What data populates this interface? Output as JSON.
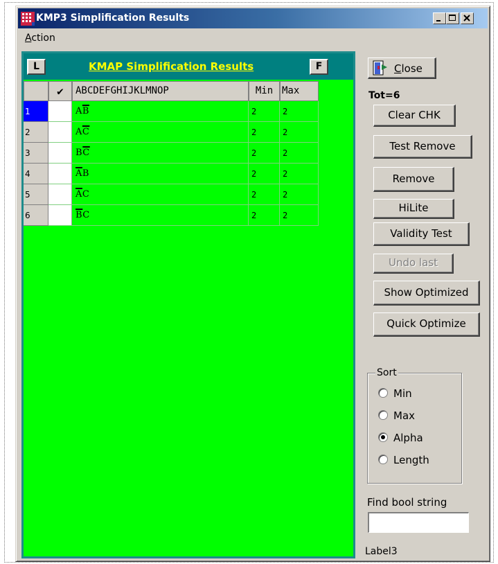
{
  "window": {
    "title": "KMP3 Simplification Results"
  },
  "menu": {
    "action_first": "A",
    "action_rest": "ction"
  },
  "grid": {
    "left_button": "L",
    "right_button": "F",
    "header_title": "KMAP Simplification Results",
    "columns": {
      "check": "✔",
      "terms": "ABCDEFGHIJKLMNOP",
      "min": "Min",
      "max": "Max"
    },
    "rows": [
      {
        "num": "1",
        "parts": [
          [
            "A",
            false
          ],
          [
            "B",
            true
          ]
        ],
        "min": "2",
        "max": "2",
        "selected": true
      },
      {
        "num": "2",
        "parts": [
          [
            "A",
            false
          ],
          [
            "C",
            true
          ]
        ],
        "min": "2",
        "max": "2",
        "selected": false
      },
      {
        "num": "3",
        "parts": [
          [
            "B",
            false
          ],
          [
            "C",
            true
          ]
        ],
        "min": "2",
        "max": "2",
        "selected": false
      },
      {
        "num": "4",
        "parts": [
          [
            "A",
            true
          ],
          [
            "B",
            false
          ]
        ],
        "min": "2",
        "max": "2",
        "selected": false
      },
      {
        "num": "5",
        "parts": [
          [
            "A",
            true
          ],
          [
            "C",
            false
          ]
        ],
        "min": "2",
        "max": "2",
        "selected": false
      },
      {
        "num": "6",
        "parts": [
          [
            "B",
            true
          ],
          [
            "C",
            false
          ]
        ],
        "min": "2",
        "max": "2",
        "selected": false
      }
    ]
  },
  "side": {
    "close_first": "C",
    "close_rest": "lose",
    "total": "Tot=6",
    "clear_chk": "Clear CHK",
    "test_remove": "Test Remove",
    "remove": "Remove",
    "hilite": "HiLite",
    "validity_test": "Validity Test",
    "undo_last": "Undo last",
    "show_optimized": "Show Optimized",
    "quick_optimize": "Quick Optimize"
  },
  "sort": {
    "legend": "Sort",
    "options": [
      "Min",
      "Max",
      "Alpha",
      "Length"
    ],
    "selected": "Alpha"
  },
  "find": {
    "label": "Find bool string",
    "value": ""
  },
  "status_label": "Label3",
  "colors": {
    "grid_bg": "#00ff00",
    "header_bg": "#008080",
    "header_text": "#ffff00",
    "selected_row": "#0000ff"
  }
}
